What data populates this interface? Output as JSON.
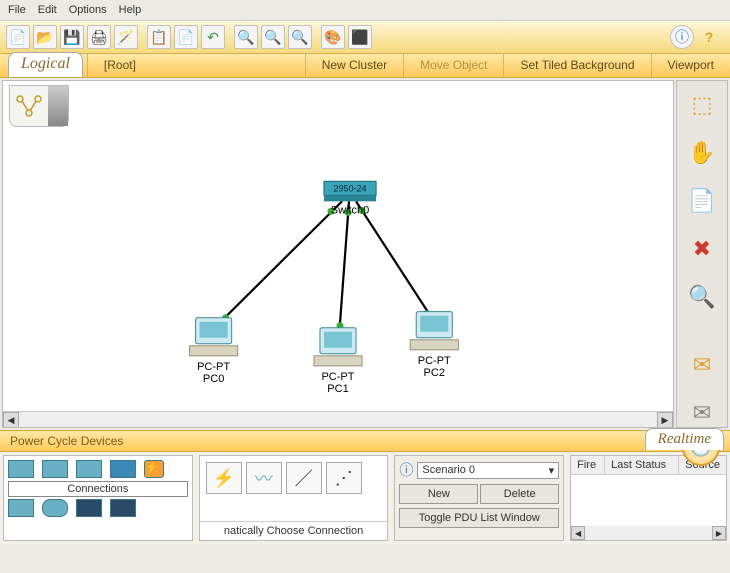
{
  "menubar": {
    "file": "File",
    "edit": "Edit",
    "options": "Options",
    "help": "Help"
  },
  "toolbar_icons": {
    "new": "new-file",
    "open": "open-folder",
    "save": "save",
    "print": "print",
    "wizard": "wizard",
    "copy": "copy",
    "paste": "paste",
    "undo": "undo",
    "zoomin": "zoom-in",
    "zoomreset": "zoom-reset",
    "zoomout": "zoom-out",
    "palette": "palette",
    "custom": "custom",
    "info": "info",
    "help": "help"
  },
  "nav": {
    "logical": "Logical",
    "root": "[Root]",
    "new_cluster": "New Cluster",
    "move_object": "Move Object",
    "set_bg": "Set Tiled Background",
    "viewport": "Viewport"
  },
  "topology": {
    "switch": {
      "model": "2950-24",
      "name": "Switch0"
    },
    "pc0": {
      "type": "PC-PT",
      "name": "PC0"
    },
    "pc1": {
      "type": "PC-PT",
      "name": "PC1"
    },
    "pc2": {
      "type": "PC-PT",
      "name": "PC2"
    }
  },
  "right_tools": {
    "select": "select",
    "move": "move",
    "note": "note",
    "delete": "delete",
    "inspect": "inspect",
    "pdu_simple": "simple-pdu",
    "pdu_complex": "complex-pdu"
  },
  "bottom": {
    "power_cycle": "Power Cycle Devices",
    "realtime": "Realtime"
  },
  "palette": {
    "connections": "Connections",
    "auto_choose": "natically Choose Connection"
  },
  "scenario": {
    "current": "Scenario 0",
    "new": "New",
    "delete": "Delete",
    "toggle": "Toggle PDU List Window"
  },
  "events": {
    "col_fire": "Fire",
    "col_last": "Last Status",
    "col_source": "Source"
  }
}
